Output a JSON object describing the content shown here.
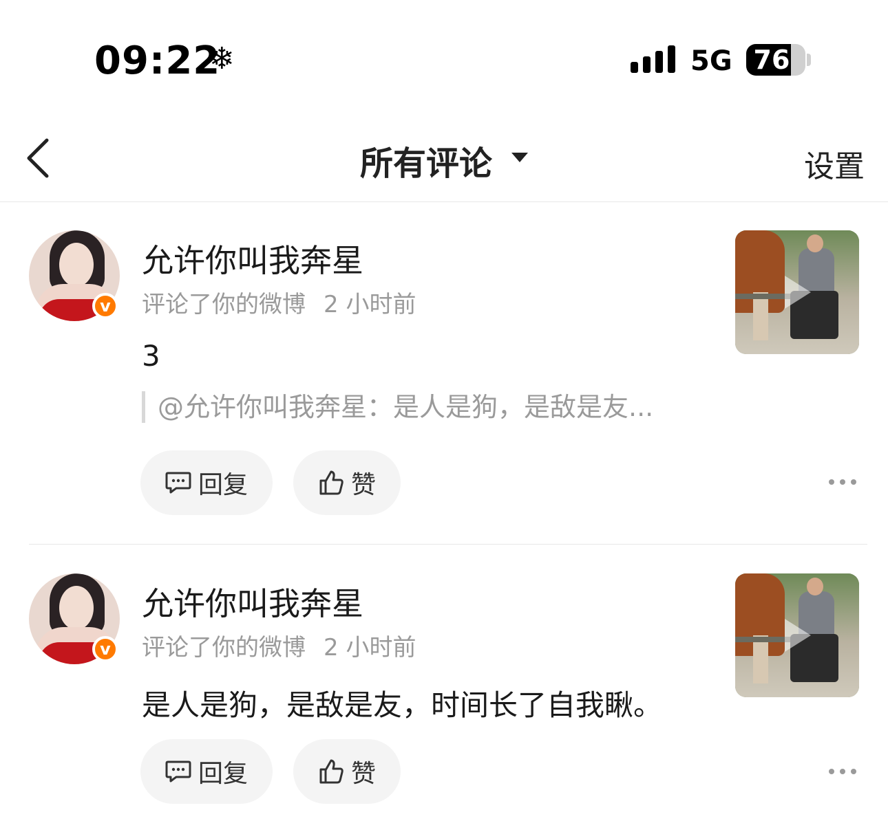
{
  "status_bar": {
    "time": "09:22",
    "weather_glyph": "❄",
    "network": "5G",
    "battery_percent": 76,
    "battery_label": "76"
  },
  "header": {
    "title": "所有评论",
    "settings_label": "设置",
    "back_icon": "chevron-left-icon"
  },
  "comments": [
    {
      "username": "允许你叫我奔星",
      "action": "评论了你的微博",
      "time": "2 小时前",
      "verified_badge": "v",
      "content": "3",
      "quote": "@允许你叫我奔星：是人是狗，是敌是友...",
      "reply_label": "回复",
      "like_label": "赞"
    },
    {
      "username": "允许你叫我奔星",
      "action": "评论了你的微博",
      "time": "2 小时前",
      "verified_badge": "v",
      "content": "是人是狗，是敌是友，时间长了自我瞅。",
      "reply_label": "回复",
      "like_label": "赞"
    }
  ],
  "colors": {
    "accent_badge": "#ff7a00",
    "muted_text": "#9a9a9a",
    "pill_bg": "#f4f4f4"
  }
}
